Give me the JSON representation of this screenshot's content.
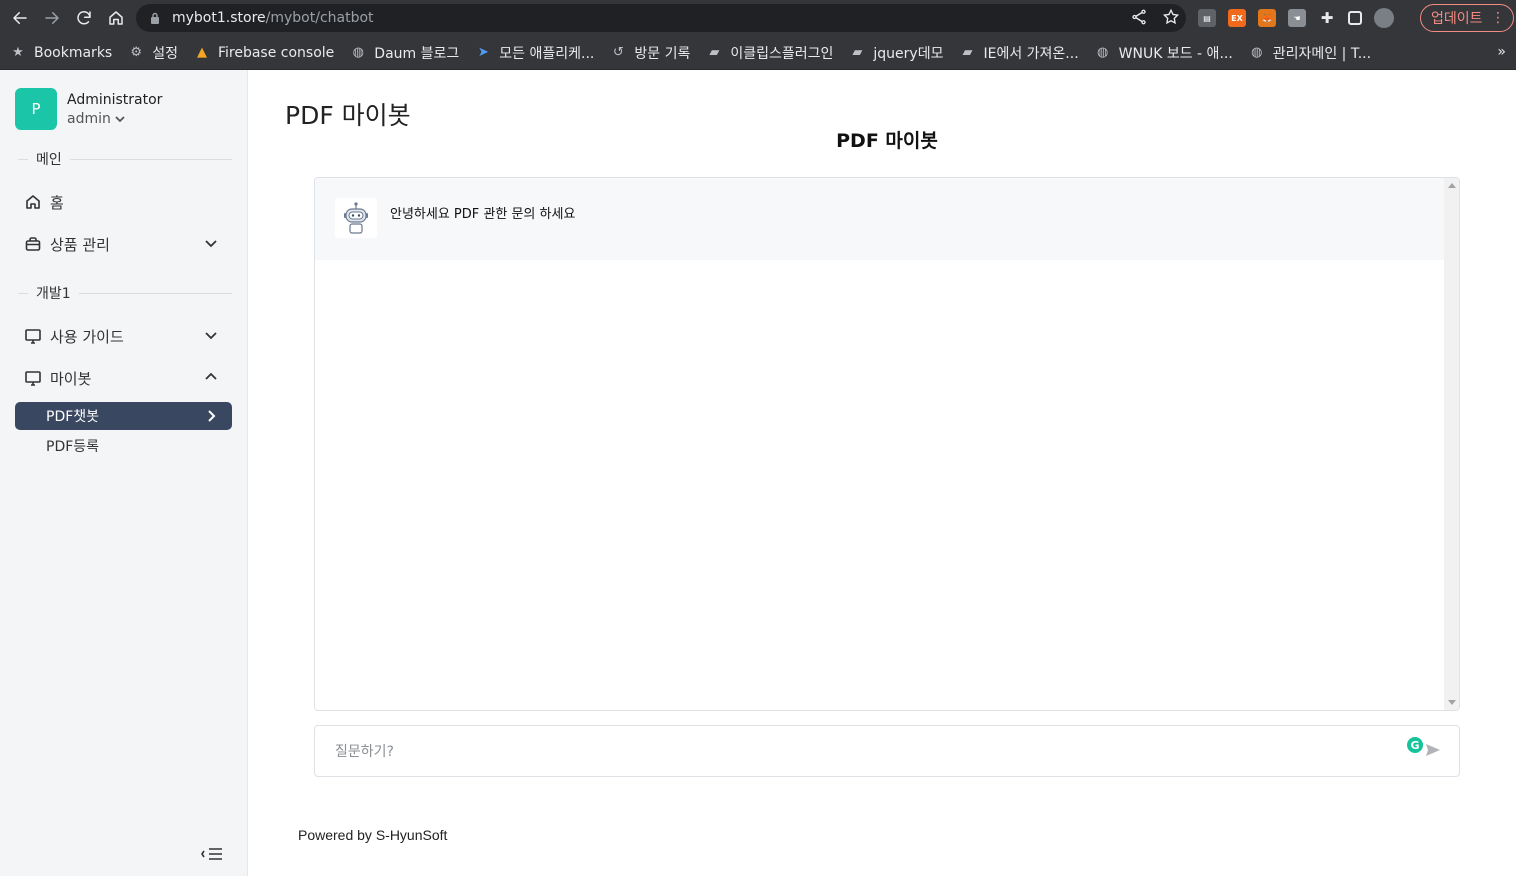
{
  "browser": {
    "url_host": "mybot1.store",
    "url_path": "/mybot/chatbot",
    "update_label": "업데이트",
    "bookmarks": [
      {
        "label": "Bookmarks",
        "icon": "star-icon"
      },
      {
        "label": "설정",
        "icon": "gear-icon"
      },
      {
        "label": "Firebase console",
        "icon": "firebase-icon"
      },
      {
        "label": "Daum 블로그",
        "icon": "globe-icon"
      },
      {
        "label": "모든 애플리케...",
        "icon": "app-icon"
      },
      {
        "label": "방문 기록",
        "icon": "history-icon"
      },
      {
        "label": "이클립스플러그인",
        "icon": "folder-icon"
      },
      {
        "label": "jquery데모",
        "icon": "folder-icon"
      },
      {
        "label": "IE에서 가져온...",
        "icon": "folder-icon"
      },
      {
        "label": "WNUK 보드 - 애...",
        "icon": "globe-icon"
      },
      {
        "label": "관리자메인 | T...",
        "icon": "globe-icon"
      }
    ],
    "more_label": "»"
  },
  "sidebar": {
    "avatar_letter": "P",
    "user_name": "Administrator",
    "user_role": "admin",
    "section_main": "메인",
    "section_dev": "개발1",
    "items": {
      "home": "홈",
      "products": "상품 관리",
      "guide": "사용 가이드",
      "mybot": "마이봇",
      "pdf_chatbot": "PDF챗봇",
      "pdf_register": "PDF등록"
    }
  },
  "main": {
    "page_title": "PDF 마이봇",
    "chat_title": "PDF 마이봇",
    "bot_message": "안녕하세요 PDF 관한 문의 하세요",
    "input_placeholder": "질문하기?",
    "footer": "Powered by S-HyunSoft"
  },
  "colors": {
    "avatar_bg": "#1bc5a7",
    "active_item_bg": "#3a4760",
    "sidebar_bg": "#f4f5f6",
    "update_border": "#f28b82"
  }
}
